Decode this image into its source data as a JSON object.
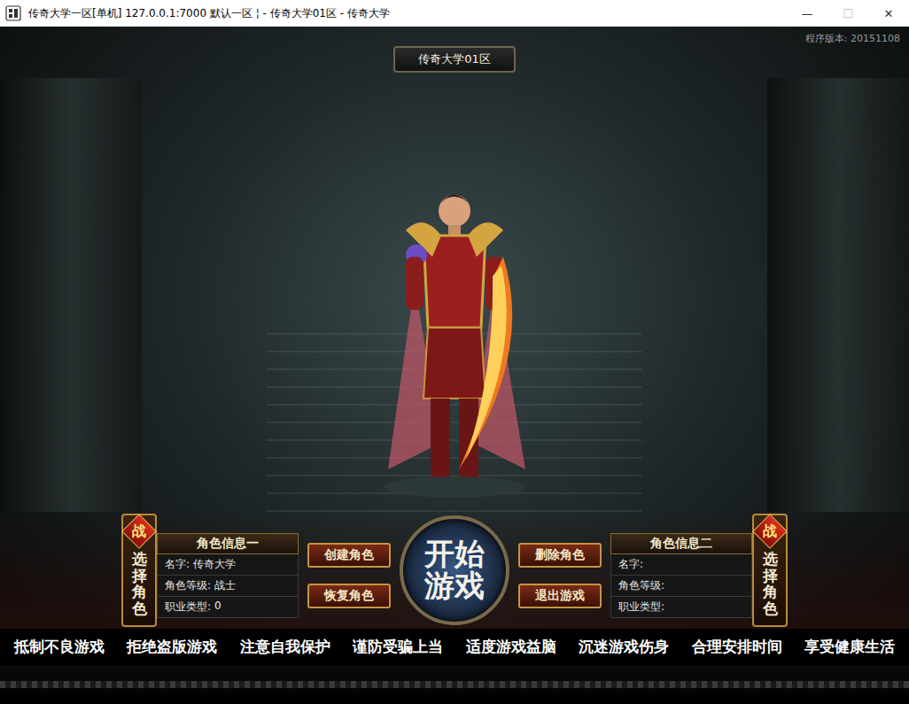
{
  "window": {
    "title": "传奇大学一区[单机] 127.0.0.1:7000   默认一区 ¦ - 传奇大学01区 - 传奇大学",
    "controls": [
      "—",
      "☐",
      "✕"
    ]
  },
  "server": {
    "name": "传奇大学01区"
  },
  "version": "程序版本: 20151108",
  "slots": [
    {
      "header": "角色信息一",
      "badge": "战",
      "select_label": "选择角色",
      "fields": [
        {
          "label": "名字:",
          "value": "传奇大学"
        },
        {
          "label": "角色等级:",
          "value": "战士"
        },
        {
          "label": "职业类型:",
          "value": "0"
        }
      ]
    },
    {
      "header": "角色信息二",
      "badge": "战",
      "select_label": "选择角色",
      "fields": [
        {
          "label": "名字:",
          "value": ""
        },
        {
          "label": "角色等级:",
          "value": ""
        },
        {
          "label": "职业类型:",
          "value": ""
        }
      ]
    }
  ],
  "left_buttons": [
    "创建角色",
    "恢复角色"
  ],
  "start_button": "开始游戏",
  "right_buttons": [
    "删除角色",
    "退出游戏"
  ],
  "slogans": [
    "抵制不良游戏",
    "拒绝盗版游戏",
    "注意自我保护",
    "谨防受骗上当",
    "适度游戏益脑",
    "沉迷游戏伤身",
    "合理安排时间",
    "享受健康生活"
  ]
}
